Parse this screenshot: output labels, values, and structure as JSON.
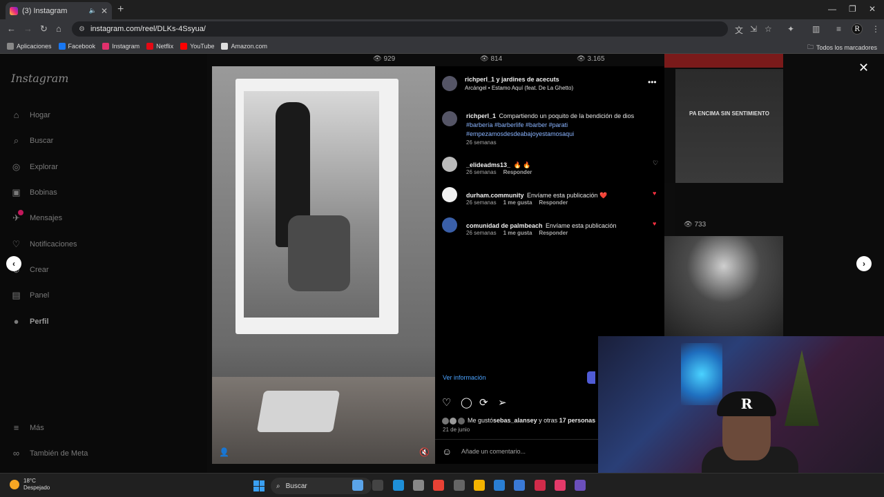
{
  "browser": {
    "tab_title": "(3) Instagram",
    "url": "instagram.com/reel/DLKs-4Ssyua/",
    "bookmarks": [
      {
        "label": "Aplicaciones",
        "color": "#888888"
      },
      {
        "label": "Facebook",
        "color": "#1877f2"
      },
      {
        "label": "Instagram",
        "color": "#e1306c"
      },
      {
        "label": "Netflix",
        "color": "#e50914"
      },
      {
        "label": "YouTube",
        "color": "#ff0000"
      },
      {
        "label": "Amazon.com",
        "color": "#dddddd"
      }
    ],
    "all_bookmarks": "Todos los marcadores"
  },
  "sidebar": {
    "logo": "Instagram",
    "items": [
      {
        "label": "Hogar",
        "icon": "home-icon",
        "glyph": "⌂"
      },
      {
        "label": "Buscar",
        "icon": "search-icon",
        "glyph": "⌕"
      },
      {
        "label": "Explorar",
        "icon": "compass-icon",
        "glyph": "◎"
      },
      {
        "label": "Bobinas",
        "icon": "reels-icon",
        "glyph": "▣"
      },
      {
        "label": "Mensajes",
        "icon": "messenger-icon",
        "glyph": "✈"
      },
      {
        "label": "Notificaciones",
        "icon": "heart-icon",
        "glyph": "♡"
      },
      {
        "label": "Crear",
        "icon": "plus-icon",
        "glyph": "⊕"
      },
      {
        "label": "Panel",
        "icon": "dashboard-icon",
        "glyph": "▤"
      },
      {
        "label": "Perfil",
        "icon": "profile-avatar-icon",
        "glyph": "●"
      }
    ],
    "more": "Más",
    "meta": "También de Meta"
  },
  "background_counts": [
    "929",
    "814",
    "3.165",
    "733"
  ],
  "background_text": "PA ENCIMA SIN SENTIMIENTO",
  "post": {
    "author": "richperl_1 y jardines de acecuts",
    "song": "Arcángel • Estamo Aquí (feat. De La Ghetto)",
    "caption": {
      "user": "richperl_1",
      "text": "Compartiendo un poquito de la bendición de dios",
      "tags": "#barbería #barberlife #barber #parati #empezamosdesdeabajoyestamosaqui",
      "time": "26 semanas"
    },
    "comments": [
      {
        "user": "_elideadms13_",
        "text": "🔥 🔥",
        "time": "26 semanas",
        "likes": "",
        "reply": "Responder",
        "liked": false
      },
      {
        "user": "durham.community",
        "text": "Envíame esta publicación ❤️",
        "time": "26 semanas",
        "likes": "1 me gusta",
        "reply": "Responder",
        "liked": true
      },
      {
        "user": "comunidad de palmbeach",
        "text": "Envíame esta publicación",
        "time": "26 semanas",
        "likes": "1 me gusta",
        "reply": "Responder",
        "liked": true
      }
    ],
    "ver_info": "Ver información",
    "likes_prefix": "Me gustó",
    "likes_user": "sebas_alansey",
    "likes_mid": " y otras ",
    "likes_count": "17 personas",
    "date": "21 de junio",
    "comment_placeholder": "Añade un comentario..."
  },
  "taskbar": {
    "temp": "18°C",
    "weather": "Despejado",
    "search": "Buscar"
  }
}
